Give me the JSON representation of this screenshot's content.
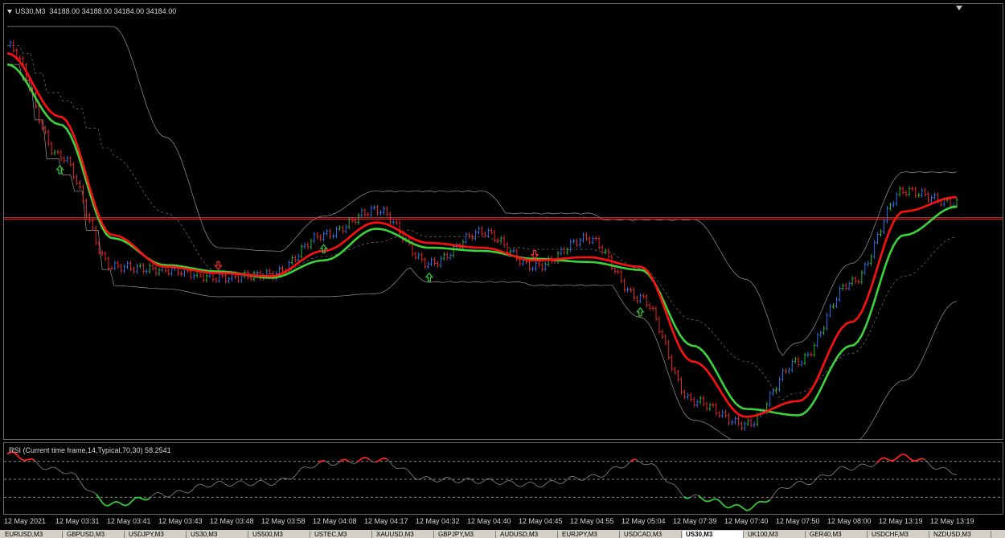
{
  "window": {
    "symbol_label": "US30,M3",
    "ohlc_label": "34188.00 34188.00 34184.00 34184.00"
  },
  "rsi": {
    "label": "RSI (Current time frame,14,Typical,70,30) 58.2541"
  },
  "colors": {
    "background": "#000000",
    "candle_up": "#2b7cff",
    "candle_up_alt": "#33cc33",
    "candle_down": "#ff2a2a",
    "ma_fast": "#ff1010",
    "ma_slow": "#3bd43b",
    "envelope": "#bdbdbd",
    "price_line": "#ff3030",
    "rsi_line": "#8a8a8a",
    "rsi_hot": "#ff2020",
    "rsi_cold": "#33cc33"
  },
  "tabs": [
    "EURUSD,M3",
    "GBPUSD,M3",
    "USDJPY,M3",
    "US30,M3",
    "US500,M3",
    "USTEC,M3",
    "XAUUSD,M3",
    "GBPJPY,M3",
    "AUDUSD,M3",
    "EURJPY,M3",
    "USDCAD,M3",
    "US30,M3",
    "UK100,M3",
    "GER40,M3",
    "USDCHF,M3",
    "NZDUSD,M3"
  ],
  "active_tab_index": 11,
  "chart_data": [
    {
      "type": "line",
      "title": "US30,M3",
      "x": [
        "12 May 2021",
        "12 May 03:31",
        "12 May 03:41",
        "12 May 03:43",
        "12 May 03:48",
        "12 May 03:58",
        "12 May 04:08",
        "12 May 04:17",
        "12 May 04:32",
        "12 May 04:40",
        "12 May 04:45",
        "12 May 04:55",
        "12 May 05:04",
        "12 May 07:39",
        "12 May 07:40",
        "12 May 07:50",
        "12 May 08:00",
        "12 May 13:19",
        "12 May 13:19"
      ],
      "series": [
        {
          "name": "price",
          "values": [
            34230,
            34160,
            34090,
            34088,
            34083,
            34085,
            34110,
            34126,
            34092,
            34112,
            34090,
            34108,
            34070,
            34005,
            33990,
            34030,
            34080,
            34138,
            34130
          ]
        },
        {
          "name": "ma_fast",
          "values": [
            34225,
            34185,
            34110,
            34090,
            34086,
            34084,
            34100,
            34118,
            34105,
            34102,
            34094,
            34096,
            34090,
            34030,
            33995,
            34005,
            34055,
            34125,
            34134
          ]
        },
        {
          "name": "ma_slow",
          "values": [
            34218,
            34180,
            34108,
            34091,
            34087,
            34083,
            34094,
            34114,
            34102,
            34100,
            34095,
            34093,
            34088,
            34040,
            34000,
            33996,
            34040,
            34110,
            34128
          ]
        }
      ],
      "horizontal_lines": [
        34121,
        34120
      ],
      "ylim": [
        33985,
        34245
      ],
      "grid": false
    },
    {
      "type": "line",
      "title": "RSI (Current time frame,14,Typical,70,30) 58.2541",
      "levels": [
        70,
        50,
        30
      ],
      "ylim": [
        15,
        85
      ],
      "series": [
        {
          "name": "RSI",
          "values": [
            78,
            60,
            22,
            33,
            45,
            46,
            68,
            72,
            50,
            48,
            44,
            52,
            70,
            30,
            18,
            45,
            63,
            75,
            58
          ]
        }
      ],
      "grid": false
    }
  ]
}
